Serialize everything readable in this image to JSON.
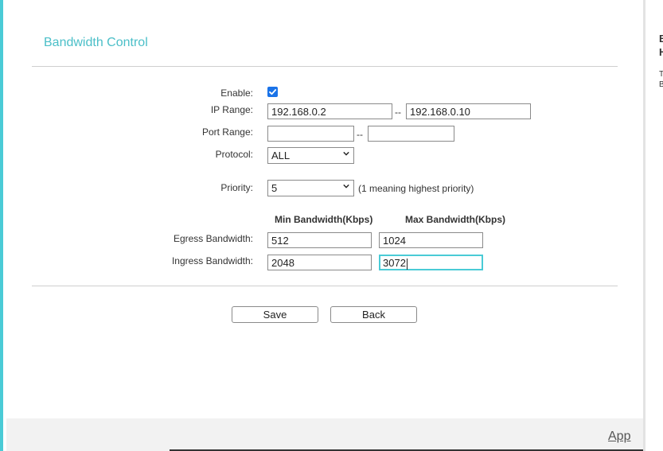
{
  "page": {
    "title": "Bandwidth Control"
  },
  "form": {
    "enable": {
      "label": "Enable:",
      "checked": true
    },
    "ip_range": {
      "label": "IP Range:",
      "start": "192.168.0.2",
      "separator": "--",
      "end": "192.168.0.10"
    },
    "port_range": {
      "label": "Port Range:",
      "start": "",
      "separator": "--",
      "end": ""
    },
    "protocol": {
      "label": "Protocol:",
      "value": "ALL"
    },
    "priority": {
      "label": "Priority:",
      "value": "5",
      "hint": "(1 meaning highest priority)"
    },
    "columns": {
      "min": "Min Bandwidth(Kbps)",
      "max": "Max Bandwidth(Kbps)"
    },
    "egress": {
      "label": "Egress Bandwidth:",
      "min": "512",
      "max": "1024"
    },
    "ingress": {
      "label": "Ingress Bandwidth:",
      "min": "2048",
      "max": "3072"
    }
  },
  "buttons": {
    "save": "Save",
    "back": "Back"
  },
  "footer": {
    "link": "App"
  },
  "right_panel": {
    "h1": "B",
    "h2": "H",
    "t1": "T",
    "t2": "B"
  },
  "colors": {
    "accent": "#4acbd6",
    "title": "#4bbfc8",
    "checkbox": "#1a73e8"
  },
  "icons": {
    "checkbox": "checkmark-icon",
    "select": "chevron-down-icon"
  }
}
